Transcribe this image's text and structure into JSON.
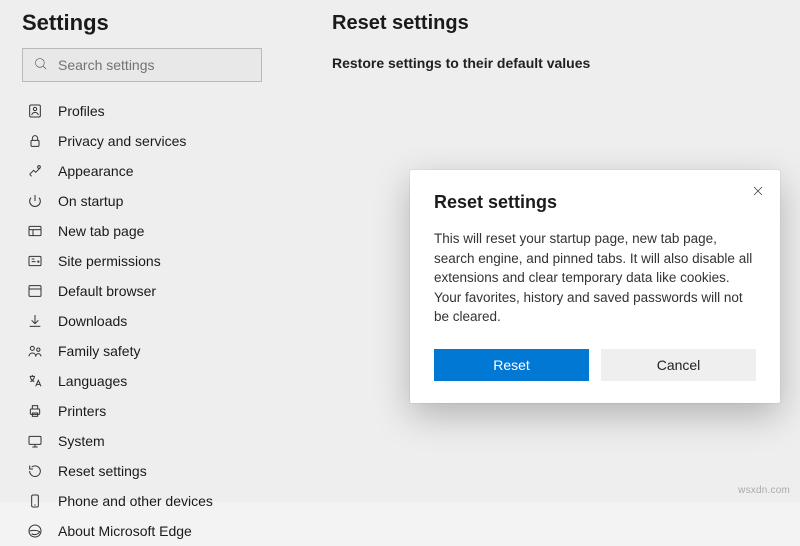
{
  "sidebar": {
    "title": "Settings",
    "search_placeholder": "Search settings",
    "items": [
      {
        "label": "Profiles"
      },
      {
        "label": "Privacy and services"
      },
      {
        "label": "Appearance"
      },
      {
        "label": "On startup"
      },
      {
        "label": "New tab page"
      },
      {
        "label": "Site permissions"
      },
      {
        "label": "Default browser"
      },
      {
        "label": "Downloads"
      },
      {
        "label": "Family safety"
      },
      {
        "label": "Languages"
      },
      {
        "label": "Printers"
      },
      {
        "label": "System"
      },
      {
        "label": "Reset settings"
      },
      {
        "label": "Phone and other devices"
      },
      {
        "label": "About Microsoft Edge"
      }
    ]
  },
  "main": {
    "heading": "Reset settings",
    "subheading": "Restore settings to their default values"
  },
  "dialog": {
    "title": "Reset settings",
    "body": "This will reset your startup page, new tab page, search engine, and pinned tabs. It will also disable all extensions and clear temporary data like cookies. Your favorites, history and saved passwords will not be cleared.",
    "primary_label": "Reset",
    "secondary_label": "Cancel"
  },
  "watermark": "wsxdn.com"
}
